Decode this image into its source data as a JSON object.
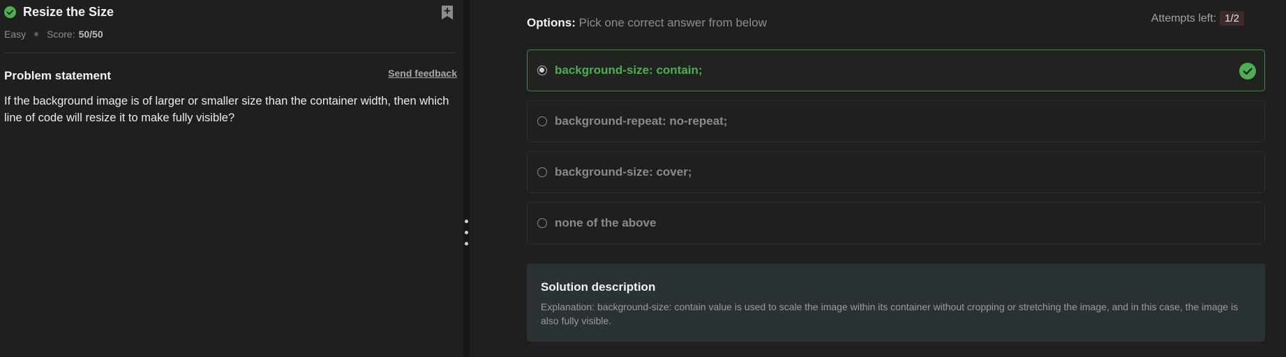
{
  "problem": {
    "title": "Resize the Size",
    "difficulty": "Easy",
    "score_label": "Score:",
    "score_value": "50/50",
    "statement_heading": "Problem statement",
    "feedback_link": "Send feedback",
    "statement": "If the background image is of larger or smaller size than the container width, then which line of code will resize it to make fully visible?"
  },
  "options": {
    "label_bold": "Options:",
    "label_rest": " Pick one correct answer from below",
    "attempts_label": "Attempts left:",
    "attempts_value": "1/2",
    "items": [
      {
        "text": "background-size: contain;",
        "selected": true,
        "correct": true
      },
      {
        "text": "background-repeat: no-repeat;",
        "selected": false,
        "correct": false
      },
      {
        "text": "background-size: cover;",
        "selected": false,
        "correct": false
      },
      {
        "text": "none of the above",
        "selected": false,
        "correct": false
      }
    ]
  },
  "solution": {
    "title": "Solution description",
    "body": "Explanation: background-size: contain value is used to scale the image within its container without cropping or stretching the image, and in this case, the image is also fully visible."
  },
  "icons": {
    "solved": "check-circle-icon",
    "bookmark": "bookmark-add-icon",
    "correct": "check-circle-icon",
    "splitter": "vertical-dots-icon"
  },
  "colors": {
    "accent_green": "#4caf50",
    "background": "#1f1f1f",
    "solution_bg": "#2b3233",
    "attempts_badge_bg": "#3e2a2a"
  }
}
